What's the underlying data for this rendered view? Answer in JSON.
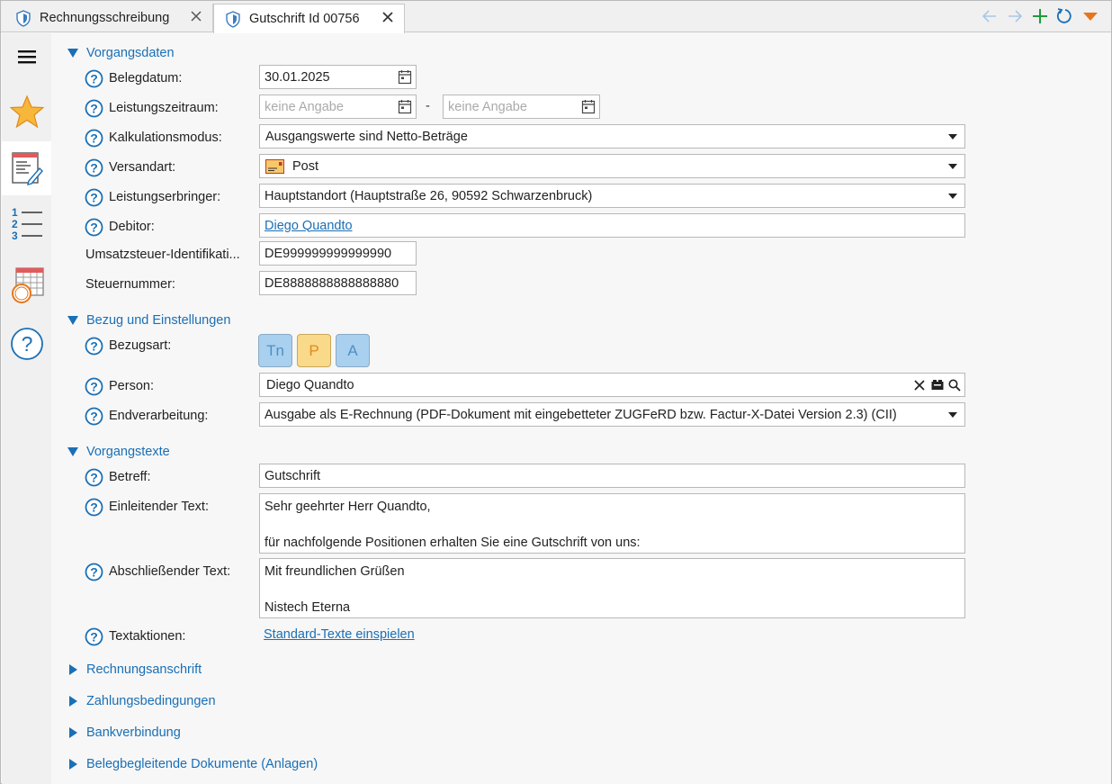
{
  "tabs": [
    {
      "label": "Rechnungsschreibung",
      "active": false
    },
    {
      "label": "Gutschrift Id 00756",
      "active": true
    }
  ],
  "toolbar": {
    "icons": [
      "arrow-left-icon",
      "arrow-right-icon",
      "plus-icon",
      "refresh-icon",
      "dropdown-triangle-icon"
    ]
  },
  "sidebar": {
    "items": [
      "menu-icon",
      "favorites-star-icon",
      "document-edit-icon",
      "numbered-list-icon",
      "calendar-icon",
      "help-icon"
    ]
  },
  "sections": {
    "vorgangsdaten": {
      "title": "Vorgangsdaten",
      "belegdatum": {
        "label": "Belegdatum:",
        "value": "30.01.2025"
      },
      "leistungszeitraum": {
        "label": "Leistungszeitraum:",
        "from_placeholder": "keine Angabe",
        "separator": "-",
        "to_placeholder": "keine Angabe"
      },
      "kalkulationsmodus": {
        "label": "Kalkulationsmodus:",
        "value": "Ausgangswerte sind Netto-Beträge"
      },
      "versandart": {
        "label": "Versandart:",
        "value": "Post"
      },
      "leistungserbringer": {
        "label": "Leistungserbringer:",
        "value": "Hauptstandort (Hauptstraße 26, 90592 Schwarzenbruck)"
      },
      "debitor": {
        "label": "Debitor:",
        "value": "Diego Quandto"
      },
      "ustid": {
        "label": "Umsatzsteuer-Identifikati...",
        "value": "DE999999999999990"
      },
      "steuernummer": {
        "label": "Steuernummer:",
        "value": "DE8888888888888880"
      }
    },
    "bezug": {
      "title": "Bezug und Einstellungen",
      "bezugsart": {
        "label": "Bezugsart:",
        "options": [
          "Tn",
          "P",
          "A"
        ],
        "selected": "P"
      },
      "person": {
        "label": "Person:",
        "value": "Diego Quandto"
      },
      "endverarbeitung": {
        "label": "Endverarbeitung:",
        "value": "Ausgabe als E-Rechnung (PDF-Dokument mit eingebetteter ZUGFeRD bzw. Factur-X-Datei Version 2.3) (CII)"
      }
    },
    "vorgangstexte": {
      "title": "Vorgangstexte",
      "betreff": {
        "label": "Betreff:",
        "value": "Gutschrift"
      },
      "einleitend": {
        "label": "Einleitender Text:",
        "line1": "Sehr geehrter Herr Quandto,",
        "line2": "",
        "line3": "für nachfolgende Positionen erhalten Sie eine Gutschrift von uns:"
      },
      "abschliessend": {
        "label": "Abschließender Text:",
        "line1": "Mit freundlichen Grüßen",
        "line2": "",
        "line3": "Nistech Eterna"
      },
      "textaktionen": {
        "label": "Textaktionen:",
        "link": "Standard-Texte einspielen"
      }
    },
    "collapsed": [
      "Rechnungsanschrift",
      "Zahlungsbedingungen",
      "Bankverbindung",
      "Belegbegleitende Dokumente (Anlagen)"
    ]
  },
  "colors": {
    "accent": "#1a6fb5",
    "green": "#1e9b3c",
    "orange": "#e8751a",
    "star": "#f5a623"
  }
}
